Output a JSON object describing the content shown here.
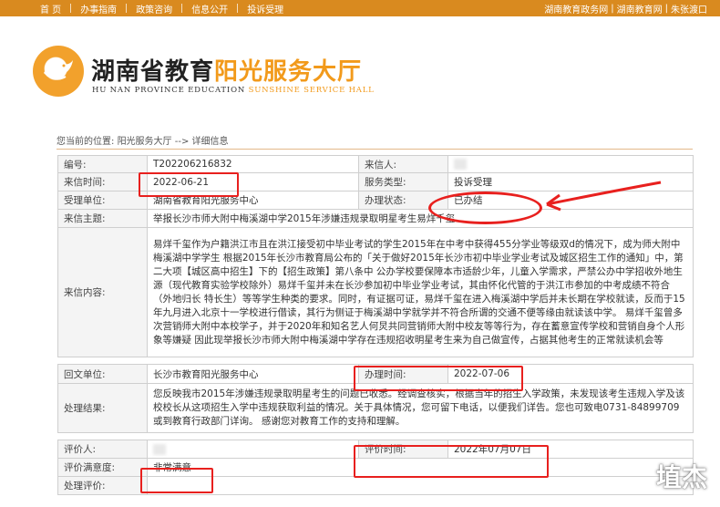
{
  "topnav": {
    "items": [
      "首 页",
      "办事指南",
      "政策咨询",
      "信息公开",
      "投诉受理"
    ],
    "right": [
      "湖南教育政务网",
      "湖南教育网",
      "朱张渡口"
    ]
  },
  "header": {
    "title_dark": "湖南省教育",
    "title_orange": "阳光服务大厅",
    "en_dark": "HU NAN PROVINCE EDUCATION ",
    "en_orange": "SUNSHINE SERVICE HALL"
  },
  "breadcrumb": {
    "prefix": "您当前的位置:",
    "link": "阳光服务大厅",
    "arrow": "-->",
    "current": "详细信息"
  },
  "letter": {
    "id_label": "编号:",
    "id_value": "T202206216832",
    "sender_label": "来信人:",
    "date_label": "来信时间:",
    "date_value": "2022-06-21",
    "type_label": "服务类型:",
    "type_value": "投诉受理",
    "unit_label": "受理单位:",
    "unit_value": "湖南省教育阳光服务中心",
    "status_label": "办理状态:",
    "status_value": "已办结",
    "subject_label": "来信主题:",
    "subject_value": "举报长沙市师大附中梅溪湖中学2015年涉嫌违规录取明星考生易烊千玺",
    "content_label": "来信内容:",
    "content_value": "易烊千玺作为户籍洪江市且在洪江接受初中毕业考试的学生2015年在中考中获得455分学业等级双d的情况下，成为师大附中梅溪湖中学学生 根据2015年长沙市教育局公布的「关于做好2015年长沙市初中毕业学业考试及城区招生工作的通知」中，第二大项【城区高中招生】下的【招生政策】第八条中 公办学校要保障本市适龄少年，儿童入学需求，严禁公办中学招收外地生源（现代教育实验学校除外）易烊千玺并未在长沙参加初中毕业学业考试，其由怀化代管的于洪江市参加的中考成绩不符合（外地归长 特长生）等等学生种类的要求。同时，有证据可证，易烊千玺在进入梅溪湖中学后并未长期在学校就读，反而于15年九月进入北京十一学校进行借读，其行为侧证于梅溪湖中学就学并不符合所谓的交通不便等缘由就读该中学。 易烊千玺曾多次营销师大附中本校学子，并于2020年和知名艺人何炅共同营销师大附中校友等等行为，存在蓄意宣传学校和营销自身个人形象等嫌疑 因此现举报长沙市师大附中梅溪湖中学存在违规招收明星考生来为自己做宣传，占据其他考生的正常就读机会等"
  },
  "reply": {
    "unit_label": "回文单位:",
    "unit_value": "长沙市教育阳光服务中心",
    "time_label": "办理时间:",
    "time_value": "2022-07-06",
    "result_label": "处理结果:",
    "result_value": "您反映我市2015年涉嫌违规录取明星考生的问题已收悉。经调查核实，根据当年的招生入学政策，未发现该考生违规入学及该校校长从这项招生入学中违规获取利益的情况。关于具体情况，您可留下电话，以便我们详告。您也可致电0731-84899709或到教育行政部门详询。 感谢您对教育工作的支持和理解。"
  },
  "evaluation": {
    "person_label": "评价人:",
    "time_label": "评价时间:",
    "time_value": "2022年07月07日",
    "satisfaction_label": "评价满意度:",
    "satisfaction_value": "非常满意",
    "comment_label": "处理评价:"
  },
  "watermark": "埴杰",
  "colors": {
    "nav_bg": "#d98a1f",
    "brand_orange": "#f29a1b",
    "annotation_red": "#e8201e",
    "label_bg": "#f4f4f4",
    "border": "#cfcfcf"
  }
}
